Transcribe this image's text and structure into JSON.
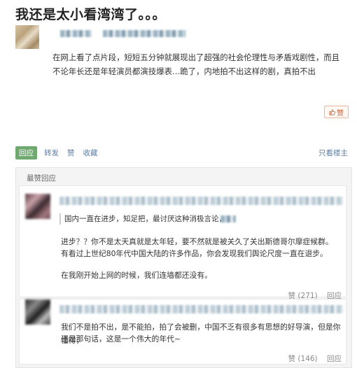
{
  "post": {
    "title": "我还是太小看湾湾了。。。",
    "content": "在网上看了点片段，短短五分钟就展现出了超强的社会伦理性与矛盾戏剧性，而且不论年长还是年轻演员都演技爆表…跪了，内地拍不出这样的剧，真拍不出",
    "like_label": "赞"
  },
  "actions": {
    "reply": "回应",
    "repost": "转发",
    "like": "赞",
    "collect": "收藏",
    "only_host": "只看楼主"
  },
  "hot_replies": {
    "header": "最赞回应",
    "items": [
      {
        "quote": "国内一直在进步，知足把，最讨厌这种消极言论，",
        "paragraph_1": "进步？？你不是太天真就是太年轻，要不然就是被关久了关出斯德哥尔摩症候群。",
        "paragraph_2": "有看过上世纪80年代中国大陆的许多作品，你会发现我们舆论尺度一直在退步。",
        "paragraph_3": "在我刚开始上网的时候，我们连墙都还没有。",
        "likes": "赞 (271)",
        "reply": "回应"
      },
      {
        "paragraph_1": "我们不是拍不出，是不能拍，拍了会被删，中国不乏有很多有思想的好导演，但是你懂得，",
        "paragraph_2": "还是那句话，这是一个伟大的年代~",
        "likes": "赞 (146)",
        "reply": "回应"
      }
    ]
  }
}
